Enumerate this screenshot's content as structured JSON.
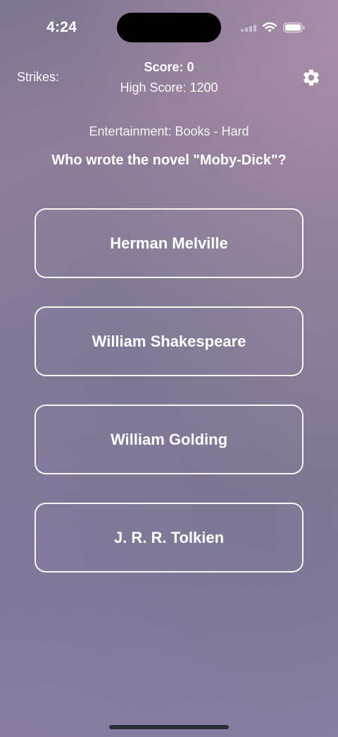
{
  "status_bar": {
    "time": "4:24",
    "icons": [
      "signal-icon",
      "wifi-icon",
      "battery-icon"
    ]
  },
  "header": {
    "strikes_label": "Strikes:",
    "score": "Score: 0",
    "high_score": "High Score: 1200",
    "settings_icon": "gear-icon"
  },
  "quiz": {
    "category": "Entertainment: Books - Hard",
    "question": "Who wrote the novel \"Moby-Dick\"?",
    "answers": [
      {
        "label": "Herman Melville"
      },
      {
        "label": "William Shakespeare"
      },
      {
        "label": "William Golding"
      },
      {
        "label": "J. R. R. Tolkien"
      }
    ]
  },
  "colors": {
    "text": "#ffffff",
    "background_top": "#8e7d99",
    "background_bottom": "#887ea0",
    "button_border": "#ffffff"
  }
}
